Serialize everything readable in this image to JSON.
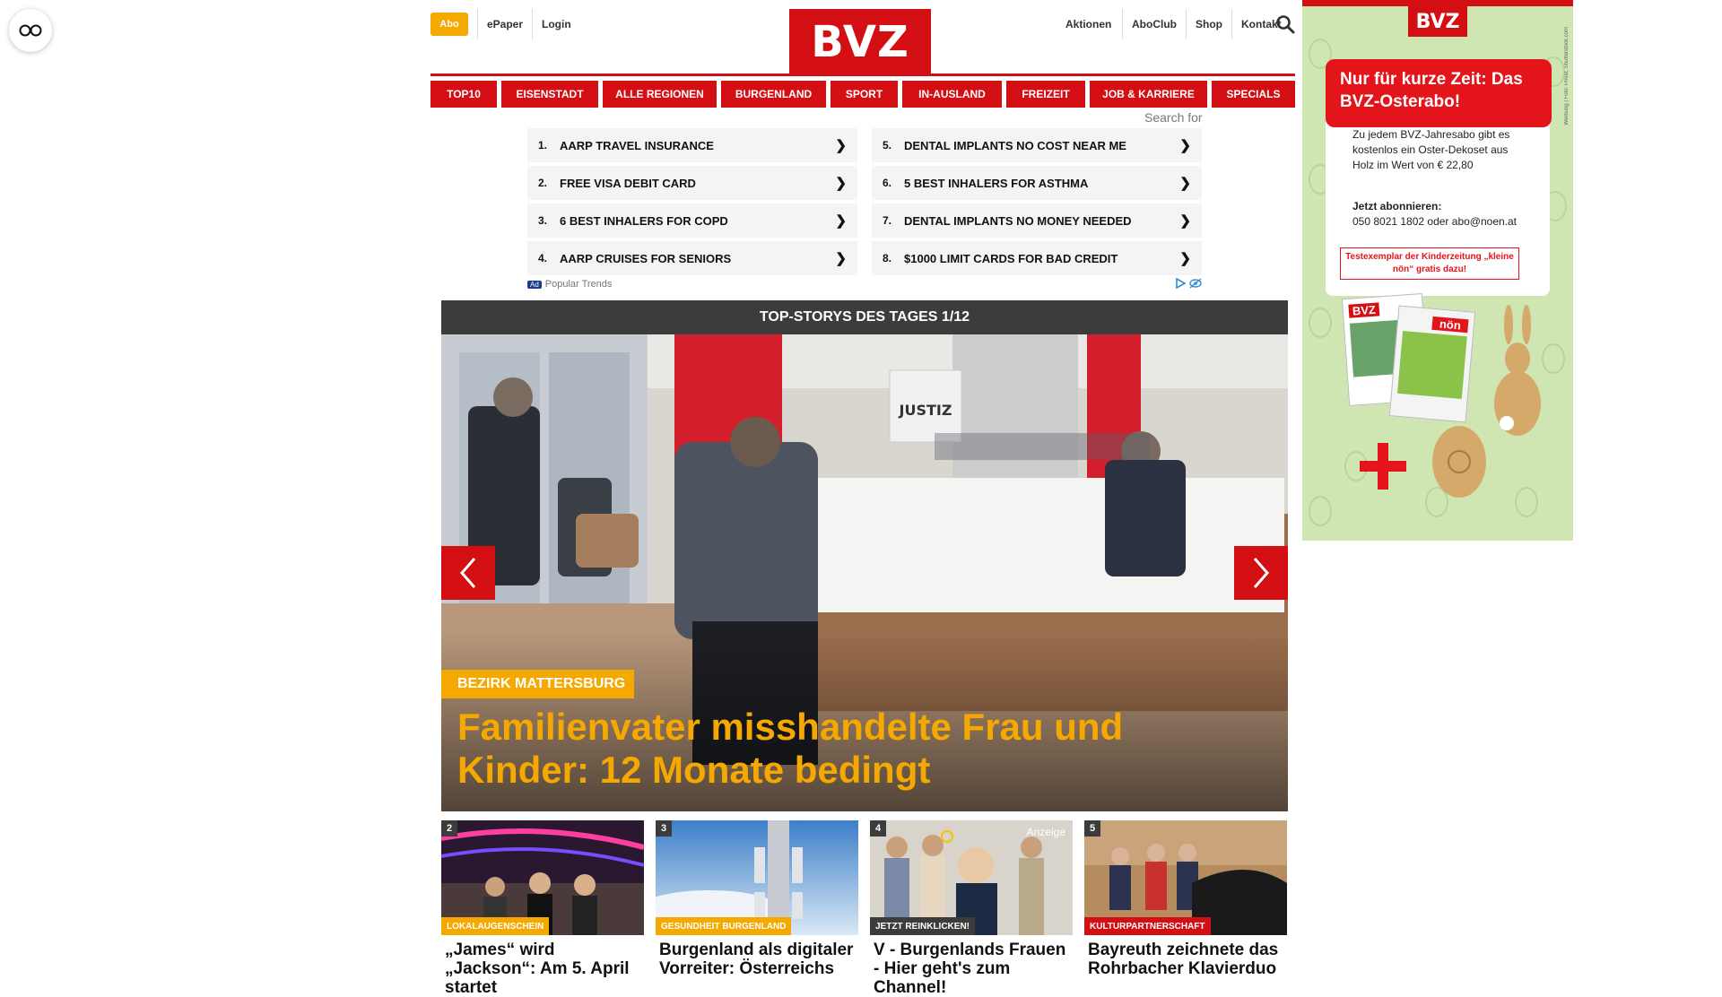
{
  "header": {
    "abo": "Abo",
    "epaper": "ePaper",
    "login": "Login",
    "logo": "BVZ",
    "aktionen": "Aktionen",
    "aboclub": "AboClub",
    "shop": "Shop",
    "kontakt": "Kontakt"
  },
  "nav": [
    "TOP10",
    "EISENSTADT",
    "ALLE REGIONEN",
    "BURGENLAND",
    "SPORT",
    "IN-AUSLAND",
    "FREIZEIT",
    "JOB & KARRIERE",
    "SPECIALS"
  ],
  "search_for": "Search for",
  "ads": {
    "left": [
      {
        "num": "1.",
        "text": "AARP TRAVEL INSURANCE"
      },
      {
        "num": "2.",
        "text": "FREE VISA DEBIT CARD"
      },
      {
        "num": "3.",
        "text": "6 BEST INHALERS FOR COPD"
      },
      {
        "num": "4.",
        "text": "AARP CRUISES FOR SENIORS"
      }
    ],
    "right": [
      {
        "num": "5.",
        "text": "DENTAL IMPLANTS NO COST NEAR ME"
      },
      {
        "num": "6.",
        "text": "5 BEST INHALERS FOR ASTHMA"
      },
      {
        "num": "7.",
        "text": "DENTAL IMPLANTS NO MONEY NEEDED"
      },
      {
        "num": "8.",
        "text": "$1000 LIMIT CARDS FOR BAD CREDIT"
      }
    ],
    "arrow": "❯",
    "badge": "Ad",
    "source": "Popular Trends"
  },
  "stories": {
    "heading": "TOP-STORYS DES TAGES 1/12",
    "hero_sign": "JUSTIZ",
    "hero_category": "BEZIRK MATTERSBURG",
    "hero_title": "Familienvater misshandelte Frau und Kinder: 12 Monate bedingt"
  },
  "teasers": [
    {
      "num": "2",
      "category": "LOKALAUGENSCHEIN",
      "cat_color": "#f5a800",
      "title": "„James“ wird „Jackson“: Am 5. April startet",
      "anzeige": ""
    },
    {
      "num": "3",
      "category": "GESUNDHEIT BURGENLAND",
      "cat_color": "#f5a800",
      "title": "Burgenland als digitaler Vorreiter: Österreichs",
      "anzeige": ""
    },
    {
      "num": "4",
      "category": "JETZT REINKLICKEN!",
      "cat_color": "#3c3c3c",
      "title": "V - Burgenlands Frauen - Hier geht's zum Channel!",
      "anzeige": "Anzeige"
    },
    {
      "num": "5",
      "category": "KULTURPARTNERSCHAFT",
      "cat_color": "#d40f14",
      "title": "Bayreuth zeichnete das Rohrbacher Klavierduo",
      "anzeige": ""
    }
  ],
  "side_ad": {
    "logo": "BVZ",
    "headline": "Nur für kurze Zeit: Das BVZ-Osterabo!",
    "text1": "Zu jedem BVZ-Jahresabo gibt es kostenlos ein Oster-Dekoset aus Holz im Wert von € 22,80",
    "cta_label": "Jetzt abonnieren:",
    "cta_contact": "050 8021 1802 oder abo@noen.at",
    "redbox": "Testexemplar der Kinderzeitung „kleine nön“ gratis dazu!",
    "credit": "Werbung | Foto: Privat, Shutterstock.com",
    "mag_bvz": "BVZ",
    "mag_non": "nön"
  },
  "colors": {
    "brand_red": "#d40f14",
    "accent_yellow": "#f5a800",
    "dark_bar": "#3c3c3c"
  }
}
